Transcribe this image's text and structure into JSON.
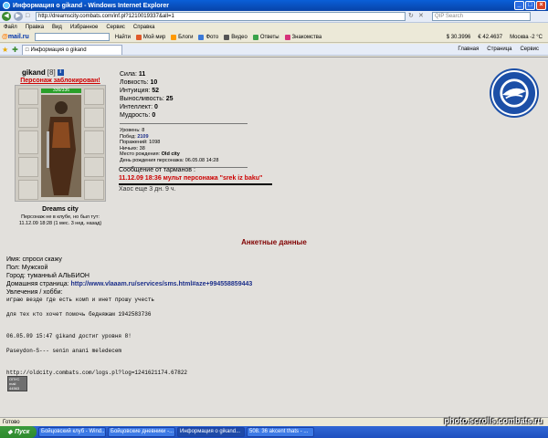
{
  "window": {
    "title": "Информация о gikand - Windows Internet Explorer",
    "buttons": {
      "min": "_",
      "max": "□",
      "close": "×"
    }
  },
  "address": {
    "url": "http://dreamscity.combats.com/inf.pl?1210019337&all=1",
    "search_placeholder": "QIP Search"
  },
  "menu": [
    "Файл",
    "Правка",
    "Вид",
    "Избранное",
    "Сервис",
    "Справка"
  ],
  "toolbar": {
    "brand": "mail",
    "brand_at": "@",
    "brand_tld": ".ru",
    "find_label": "Найти",
    "items": [
      "Мой мир",
      "Блоги",
      "Фото",
      "Видео",
      "Ответы",
      "Знакомства"
    ],
    "usd": "$ 30.3996",
    "eur": "€ 42.4637",
    "weather": "Москва -2 °C"
  },
  "tab": {
    "label": "Информация о gikand",
    "tools": [
      "Главная",
      "Страница",
      "Сервис"
    ]
  },
  "character": {
    "name": "gikand",
    "level": "[8]",
    "info_icon": "i",
    "blocked": "Персонаж заблокирован!",
    "hp": "336/336",
    "city": "Dreams city",
    "online_info_1": "Персонаж не в клубе, но был тут:",
    "online_info_2": "11.12.09 18:28 (1 мес. 3 нед. назад)"
  },
  "stats": {
    "sila": "Сила:",
    "sila_v": "11",
    "lovk": "Ловкость:",
    "lovk_v": "10",
    "intu": "Интуиция:",
    "intu_v": "52",
    "vyn": "Выносливость:",
    "vyn_v": "25",
    "intel": "Интеллект:",
    "intel_v": "0",
    "mudr": "Мудрость:",
    "mudr_v": "0",
    "levels": "Уровень: 8",
    "wins": "Побед:",
    "wins_v": "2109",
    "losses": "Поражений: 1098",
    "draws": "Ничьих: 38",
    "birthplace": "Место рождения:",
    "birthplace_v": "Old city",
    "birthday": "День рождения персонажа: 06.05.08 14:28"
  },
  "tarman": {
    "header": "Сообщение от тарманов :",
    "message": "11.12.09 18:36 мульт персонажа \"srek iz baku\"",
    "chaos": "Хаос еще 3 дн. 9 ч."
  },
  "anket": {
    "title": "Анкетные данные",
    "name": "Имя: спроси скажу",
    "sex": "Пол: Мужской",
    "city": "Город: туманный АЛЬБИОН",
    "homepage_label": "Домашняя страница:",
    "homepage": "http://www.vlaaam.ru/services/sms.html#aze+994558859443",
    "hobby": "Увлечения / хобби:",
    "line1": "играю везде где есть комп и инет прошу учесть",
    "line2": "для тех кто хочет помочь бедняжам 1942583736",
    "line3": "06.05.09 15:47 gikand достиг уровня 8!",
    "line4": "Paseydon-S--- senin anani meledecem",
    "line5": "http://oldcity.combats.com/logs.pl?log=1241621174.67822"
  },
  "counter": {
    "line1": "ОПУС",
    "line2": "mail",
    "line3": "44563"
  },
  "status": {
    "left": "Готово",
    "zone": "Интернет"
  },
  "taskbar": {
    "start": "Пуск",
    "tasks": [
      "Бойцовский клуб - Wind...",
      "Бойцовские дневники -...",
      "Информация о gikand...",
      "508. 36 akcent thats - ..."
    ]
  },
  "watermark": "photo.scrolls.combats.ru"
}
